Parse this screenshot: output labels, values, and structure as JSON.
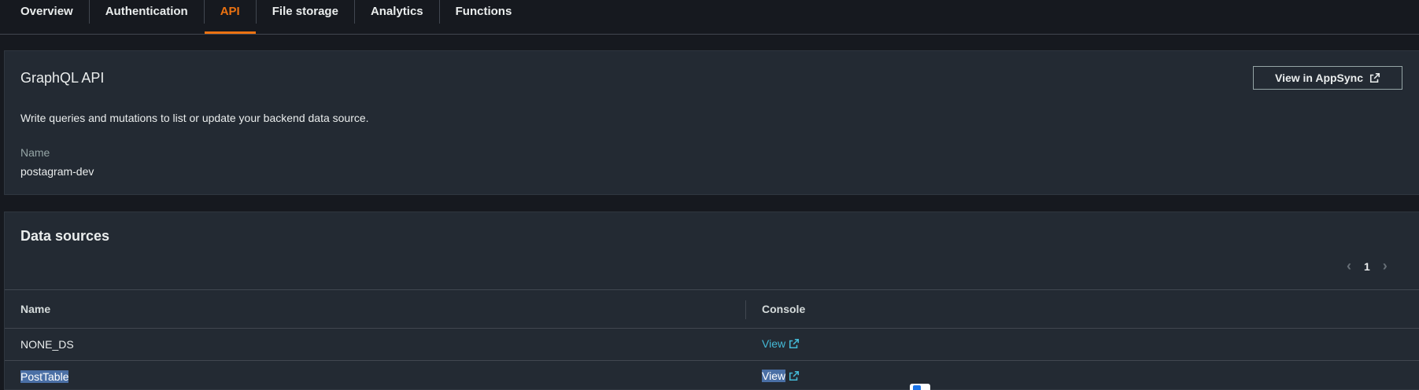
{
  "tabs": [
    {
      "label": "Overview",
      "active": false
    },
    {
      "label": "Authentication",
      "active": false
    },
    {
      "label": "API",
      "active": true
    },
    {
      "label": "File storage",
      "active": false
    },
    {
      "label": "Analytics",
      "active": false
    },
    {
      "label": "Functions",
      "active": false
    }
  ],
  "graphql": {
    "title": "GraphQL API",
    "view_button": "View in AppSync",
    "description": "Write queries and mutations to list or update your backend data source.",
    "name_label": "Name",
    "name_value": "postagram-dev"
  },
  "data_sources": {
    "title": "Data sources",
    "page": "1",
    "columns": [
      "Name",
      "Console"
    ],
    "rows": [
      {
        "name": "NONE_DS",
        "console": "View"
      },
      {
        "name": "PostTable",
        "console": "View"
      }
    ]
  },
  "colors": {
    "accent": "#ec7211",
    "link": "#44b9d6",
    "background": "#16191f",
    "panel": "#232a33",
    "selection": "#4a6fa5"
  },
  "icons": [
    "external-link-icon",
    "chevron-left-icon",
    "chevron-right-icon"
  ]
}
